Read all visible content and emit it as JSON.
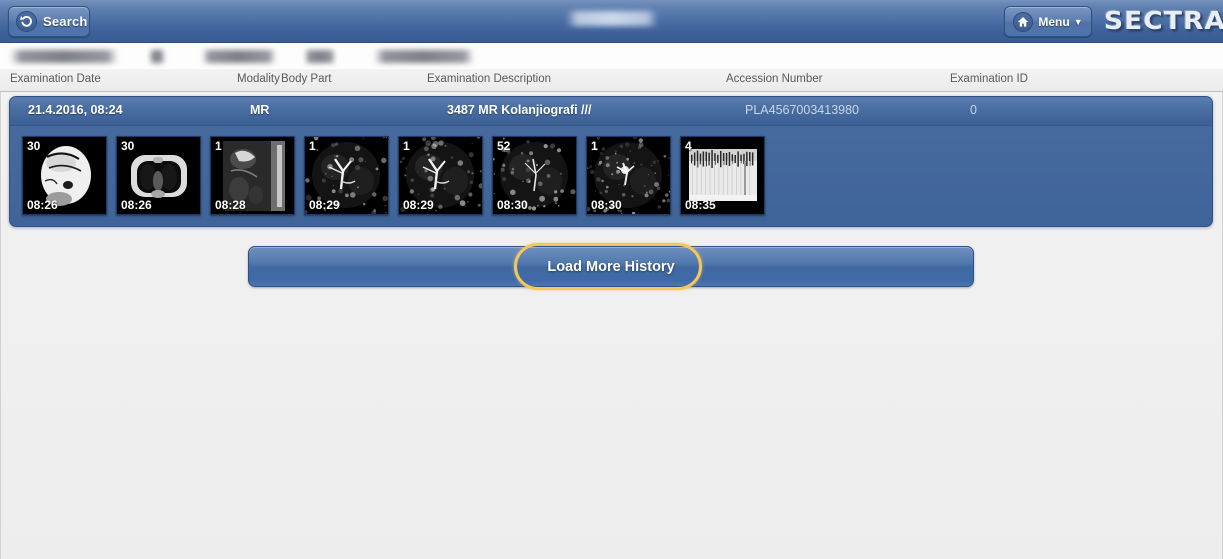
{
  "header": {
    "search_label": "Search",
    "search_icon": "undo-arrow-icon",
    "menu_label": "Menu",
    "menu_icon": "home-icon",
    "menu_chevron": "▼",
    "brand": "SECTRA",
    "center_text_redacted": true
  },
  "patient_bar": {
    "redacted": true,
    "fields": [
      "name",
      "sex",
      "birth-date",
      "age",
      "patient-id"
    ]
  },
  "columns": {
    "examination_date": "Examination Date",
    "modality": "Modality",
    "body_part": "Body Part",
    "examination_description": "Examination Description",
    "accession_number": "Accession Number",
    "examination_id": "Examination ID"
  },
  "exam": {
    "date": "21.4.2016, 08:24",
    "modality": "MR",
    "body_part": "",
    "description": "3487 MR Kolanjiografi ///",
    "accession_number": "PLA4567003413980",
    "examination_id": "0",
    "series": [
      {
        "count": "30",
        "time": "08:26",
        "kind": "mr-abdomen-bright"
      },
      {
        "count": "30",
        "time": "08:26",
        "kind": "mr-axial-chest"
      },
      {
        "count": "1",
        "time": "08:28",
        "kind": "mr-coronal-dark"
      },
      {
        "count": "1",
        "time": "08:29",
        "kind": "mrcp-tree"
      },
      {
        "count": "1",
        "time": "08:29",
        "kind": "mrcp-tree"
      },
      {
        "count": "52",
        "time": "08:30",
        "kind": "mrcp-thin"
      },
      {
        "count": "1",
        "time": "08:30",
        "kind": "mrcp-speckle"
      },
      {
        "count": "4",
        "time": "08:35",
        "kind": "dose-report"
      }
    ]
  },
  "actions": {
    "load_more_history": "Load More History"
  },
  "colors": {
    "header_top": "#7691bd",
    "header_bottom": "#395c95",
    "panel_blue": "#42689c",
    "focus_ring": "#f2c75c",
    "page_bg": "#f1f1f1"
  }
}
